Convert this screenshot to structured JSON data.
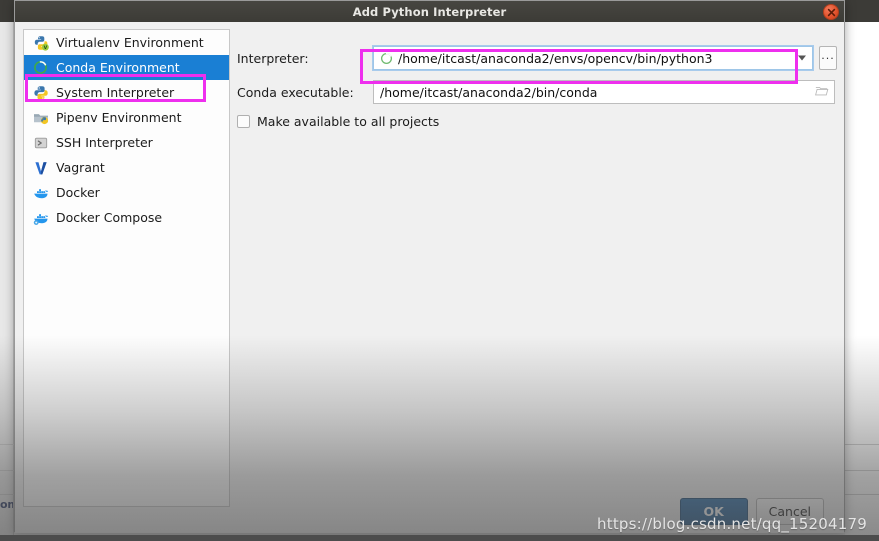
{
  "window": {
    "title": "Add Python Interpreter",
    "close_label": "close-window"
  },
  "sidebar": {
    "items": [
      {
        "label": "Virtualenv Environment",
        "icon": "python-virtualenv-icon",
        "selected": false
      },
      {
        "label": "Conda Environment",
        "icon": "conda-icon",
        "selected": true
      },
      {
        "label": "System Interpreter",
        "icon": "python-icon",
        "selected": false
      },
      {
        "label": "Pipenv Environment",
        "icon": "pipenv-folder-icon",
        "selected": false
      },
      {
        "label": "SSH Interpreter",
        "icon": "ssh-terminal-icon",
        "selected": false
      },
      {
        "label": "Vagrant",
        "icon": "vagrant-icon",
        "selected": false
      },
      {
        "label": "Docker",
        "icon": "docker-icon",
        "selected": false
      },
      {
        "label": "Docker Compose",
        "icon": "docker-compose-icon",
        "selected": false
      }
    ]
  },
  "form": {
    "interpreter": {
      "label": "Interpreter:",
      "value": "/home/itcast/anaconda2/envs/opencv/bin/python3",
      "icon": "conda-icon",
      "dropdown_icon": "chevron-down-icon",
      "browse_label": "..."
    },
    "conda_executable": {
      "label": "Conda executable:",
      "value": "/home/itcast/anaconda2/bin/conda",
      "browse_icon": "folder-icon"
    },
    "make_available": {
      "label": "Make available to all projects",
      "checked": false
    }
  },
  "footer": {
    "ok_label": "OK",
    "cancel_label": "Cancel"
  },
  "annotations": {
    "highlight_color": "#ee2fee",
    "sidebar_target": "Conda Environment",
    "interpreter_target": "Interpreter field"
  },
  "watermark": {
    "text": "https://blog.csdn.net/qq_15204179"
  },
  "background": {
    "left_fragment_text": "om"
  },
  "colors": {
    "selection_blue": "#1a7fd4",
    "titlebar": "#3c3b37",
    "close_button": "#e0502a",
    "primary_button": "#2f6fa8",
    "conda_green": "#43a047"
  }
}
